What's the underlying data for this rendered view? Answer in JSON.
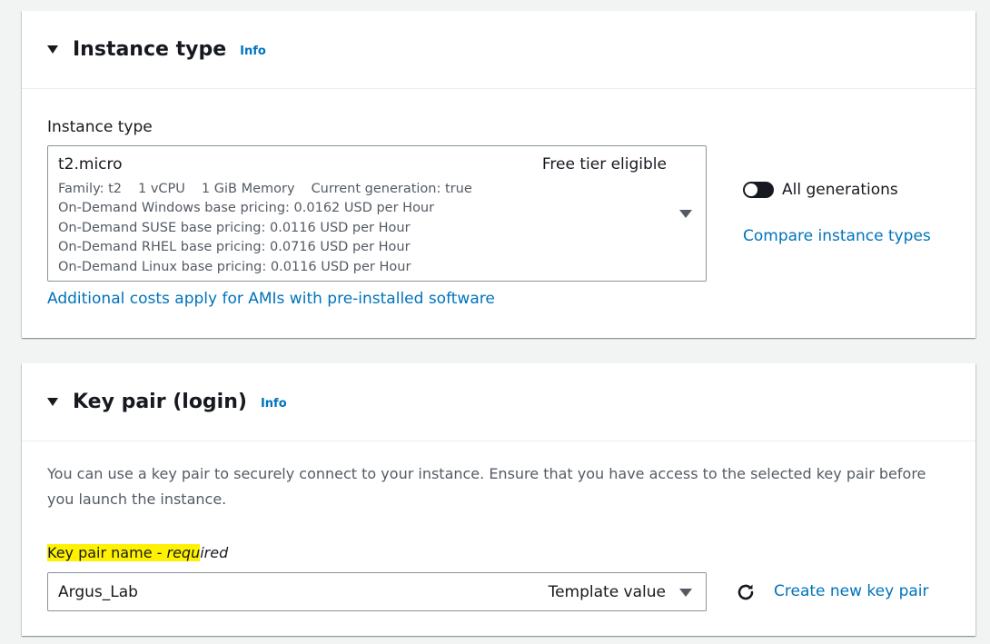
{
  "instance_type_panel": {
    "title": "Instance type",
    "info_label": "Info",
    "field_label": "Instance type",
    "selected": {
      "name": "t2.micro",
      "badge": "Free tier eligible",
      "family": "Family: t2",
      "vcpu": "1 vCPU",
      "memory": "1 GiB Memory",
      "generation": "Current generation: true",
      "pricing": [
        "On-Demand Windows base pricing: 0.0162 USD per Hour",
        "On-Demand SUSE base pricing: 0.0116 USD per Hour",
        "On-Demand RHEL base pricing: 0.0716 USD per Hour",
        "On-Demand Linux base pricing: 0.0116 USD per Hour"
      ]
    },
    "toggle_label": "All generations",
    "toggle_on": true,
    "compare_link": "Compare instance types",
    "additional_costs_link": "Additional costs apply for AMIs with pre-installed software"
  },
  "key_pair_panel": {
    "title": "Key pair (login)",
    "info_label": "Info",
    "description": "You can use a key pair to securely connect to your instance. Ensure that you have access to the selected key pair before you launch the instance.",
    "field_label_highlighted": "Key pair name - ",
    "field_label_required_hl": "requ",
    "field_label_required_rest": "ired",
    "selected_value": "Argus_Lab",
    "template_value_label": "Template value",
    "create_link": "Create new key pair"
  },
  "colors": {
    "link": "#0073bb",
    "highlight": "#fff200",
    "background": "#f2f3f3",
    "text": "#16191f",
    "muted": "#545b64"
  },
  "icons": [
    "caret-down-icon",
    "dropdown-arrow-icon",
    "refresh-icon",
    "toggle-icon"
  ]
}
